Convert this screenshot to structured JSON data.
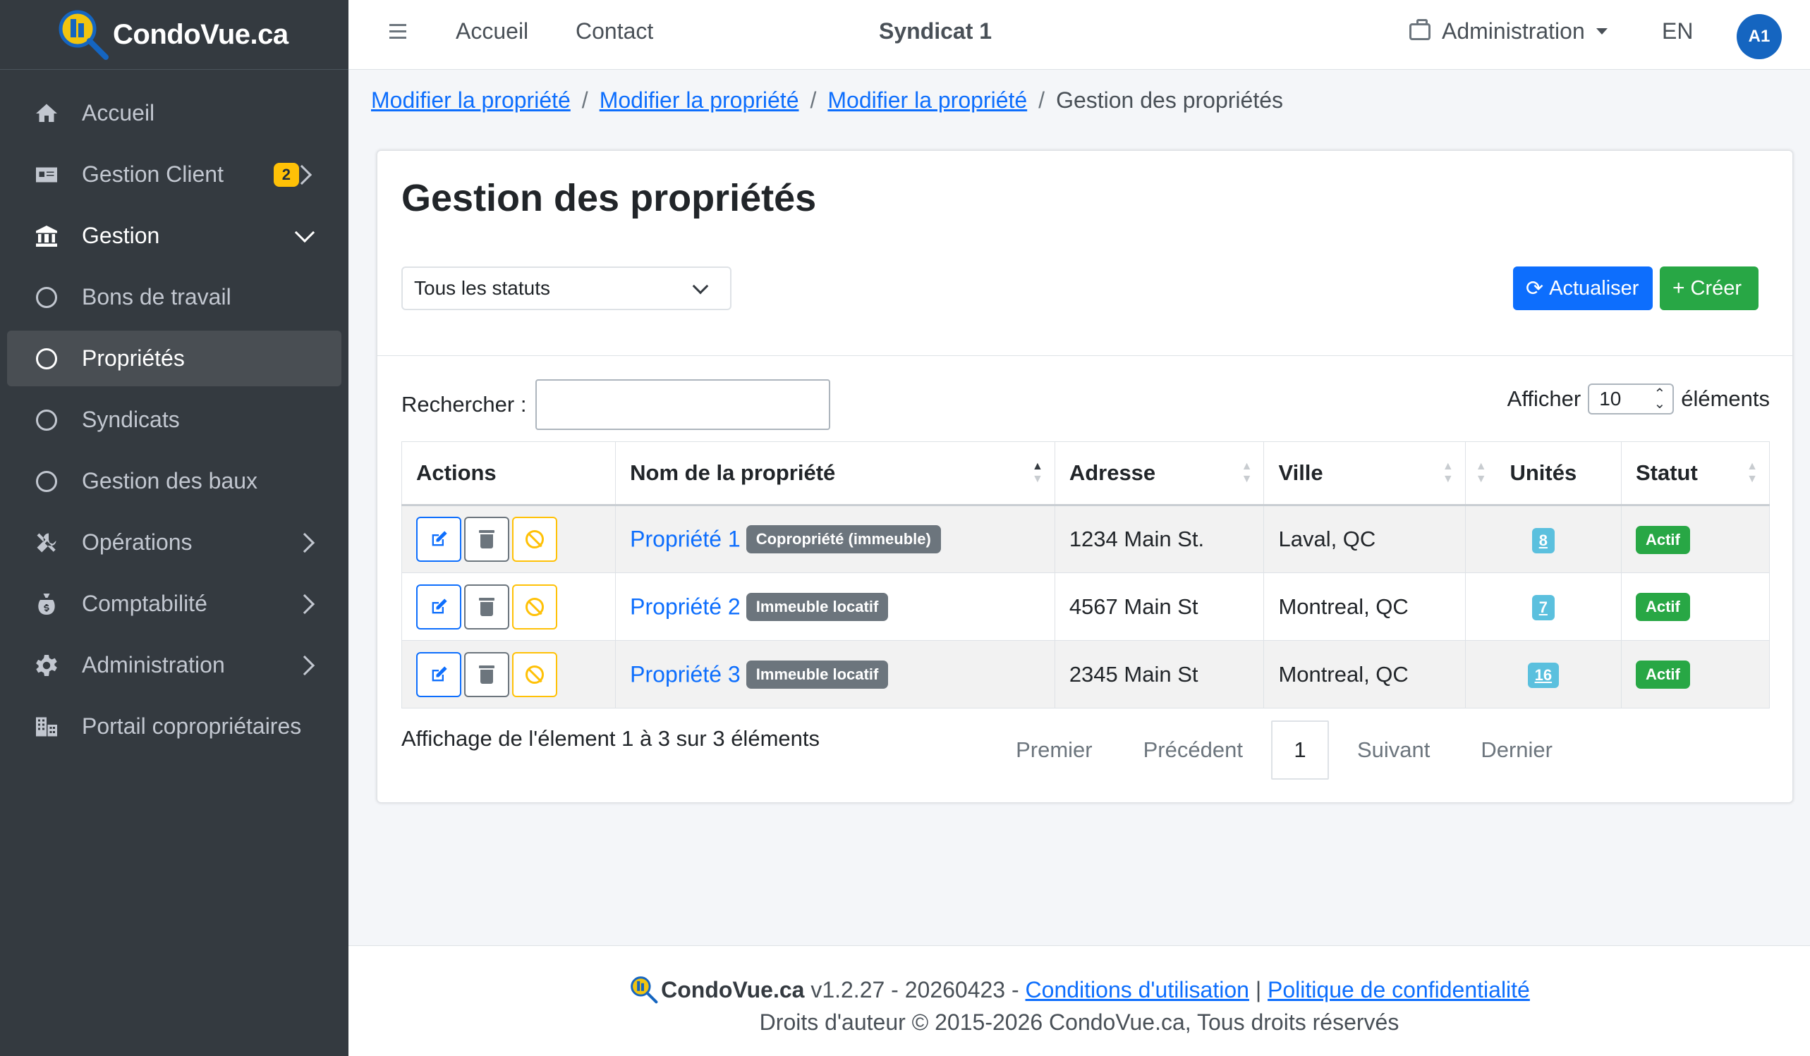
{
  "brand": {
    "name": "CondoVue.ca"
  },
  "sidebar": {
    "items": [
      {
        "label": "Accueil",
        "icon": "home-icon"
      },
      {
        "label": "Gestion Client",
        "icon": "id-card-icon",
        "badge": "2"
      },
      {
        "label": "Gestion",
        "icon": "bank-icon"
      },
      {
        "label": "Bons de travail",
        "icon": "circle-icon"
      },
      {
        "label": "Propriétés",
        "icon": "circle-icon"
      },
      {
        "label": "Syndicats",
        "icon": "circle-icon"
      },
      {
        "label": "Gestion des baux",
        "icon": "circle-icon"
      },
      {
        "label": "Opérations",
        "icon": "tools-icon"
      },
      {
        "label": "Comptabilité",
        "icon": "money-bag-icon"
      },
      {
        "label": "Administration",
        "icon": "gear-icon"
      },
      {
        "label": "Portail copropriétaires",
        "icon": "buildings-icon"
      }
    ]
  },
  "topbar": {
    "links": [
      "Accueil",
      "Contact"
    ],
    "title": "Syndicat 1",
    "admin_label": "Administration",
    "lang": "EN",
    "avatar": "A1"
  },
  "breadcrumb": {
    "links": [
      "Modifier la propriété",
      "Modifier la propriété",
      "Modifier la propriété"
    ],
    "current": "Gestion des propriétés"
  },
  "main": {
    "title": "Gestion des propriétés",
    "status_filter": "Tous les statuts",
    "refresh_label": "Actualiser",
    "create_label": "Créer",
    "search_label": "Rechercher :",
    "search_value": "",
    "show_label": "Afficher",
    "show_value": "10",
    "show_suffix": "éléments",
    "columns": [
      "Actions",
      "Nom de la propriété",
      "Adresse",
      "Ville",
      "Unités",
      "Statut"
    ],
    "rows": [
      {
        "name": "Propriété 1",
        "type": "Copropriété (immeuble)",
        "address": "1234 Main St.",
        "city": "Laval, QC",
        "units": "8",
        "status": "Actif"
      },
      {
        "name": "Propriété 2",
        "type": "Immeuble locatif",
        "address": "4567 Main St",
        "city": "Montreal, QC",
        "units": "7",
        "status": "Actif"
      },
      {
        "name": "Propriété 3",
        "type": "Immeuble locatif",
        "address": "2345 Main St",
        "city": "Montreal, QC",
        "units": "16",
        "status": "Actif"
      }
    ],
    "info": "Affichage de l'élement 1 à 3 sur 3 éléments",
    "pagination": {
      "first": "Premier",
      "prev": "Précédent",
      "current": "1",
      "next": "Suivant",
      "last": "Dernier"
    }
  },
  "footer": {
    "brand": "CondoVue.ca",
    "version": " v1.2.27 - 20260423 - ",
    "terms": "Conditions d'utilisation",
    "separator": " | ",
    "privacy": "Politique de confidentialité",
    "copyright": "Droits d'auteur © 2015-2026 CondoVue.ca, Tous droits réservés"
  },
  "colors": {
    "sidebar_bg": "#343a40",
    "primary": "#0d6efd",
    "success": "#28a745",
    "warning": "#ffc107",
    "info": "#5bc0de",
    "secondary": "#6c757d"
  }
}
